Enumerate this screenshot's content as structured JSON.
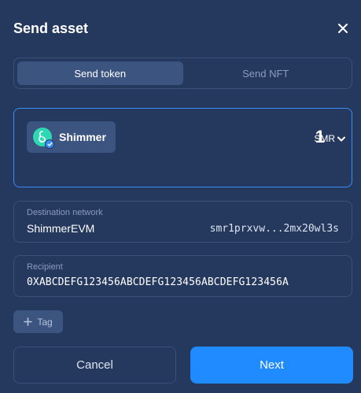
{
  "dialog": {
    "title": "Send asset"
  },
  "tabs": [
    {
      "label": "Send token",
      "active": true
    },
    {
      "label": "Send NFT",
      "active": false
    }
  ],
  "amount_card": {
    "token_name": "Shimmer",
    "token_icon": "shimmer-logo-icon",
    "amount": "1",
    "unit": "SMR"
  },
  "destination": {
    "label": "Destination network",
    "network": "ShimmerEVM",
    "address": "smr1prxvw...2mx20wl3s"
  },
  "recipient": {
    "label": "Recipient",
    "value": "0XABCDEFG123456ABCDEFG123456ABCDEFG123456A"
  },
  "tag_button": {
    "label": "Tag"
  },
  "actions": {
    "cancel": "Cancel",
    "next": "Next"
  },
  "colors": {
    "background": "#25395f",
    "accent": "#1f8bff",
    "focus_border": "#3c8bf7",
    "token_teal": "#2fd8b4"
  }
}
